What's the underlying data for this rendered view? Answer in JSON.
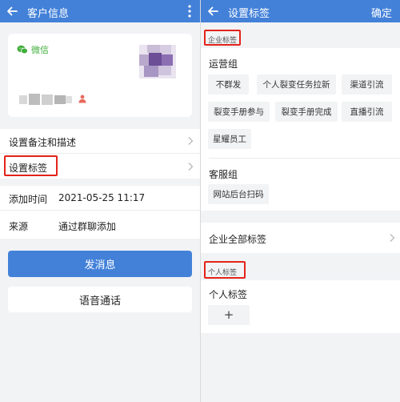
{
  "left": {
    "header": {
      "title": "客户信息"
    },
    "profile": {
      "source_label": "微信"
    },
    "rows": {
      "remark": "设置备注和描述",
      "tags": "设置标签",
      "added_time_label": "添加时间",
      "added_time_value": "2021-05-25 11:17",
      "source_label": "来源",
      "source_value": "通过群聊添加"
    },
    "buttons": {
      "send_message": "发消息",
      "voice_call": "语音通话"
    }
  },
  "right": {
    "header": {
      "title": "设置标签",
      "confirm": "确定"
    },
    "enterprise_section": "企业标签",
    "groups": [
      {
        "title": "运营组",
        "tags": [
          "不群发",
          "个人裂变任务拉新",
          "渠道引流",
          "裂变手册参与",
          "裂变手册完成",
          "直播引流",
          "星耀员工"
        ]
      },
      {
        "title": "客服组",
        "tags": [
          "网站后台扫码"
        ]
      }
    ],
    "all_enterprise_tags": "企业全部标签",
    "personal_section": "个人标签",
    "personal_title": "个人标签",
    "add_symbol": "+"
  },
  "colors": {
    "brand_blue": "#4381d9",
    "highlight_red": "#e3231a",
    "wechat_green": "#3fae3a"
  },
  "icons": [
    "back-arrow-icon",
    "more-vertical-icon",
    "wechat-icon",
    "person-icon",
    "chevron-right-icon"
  ]
}
